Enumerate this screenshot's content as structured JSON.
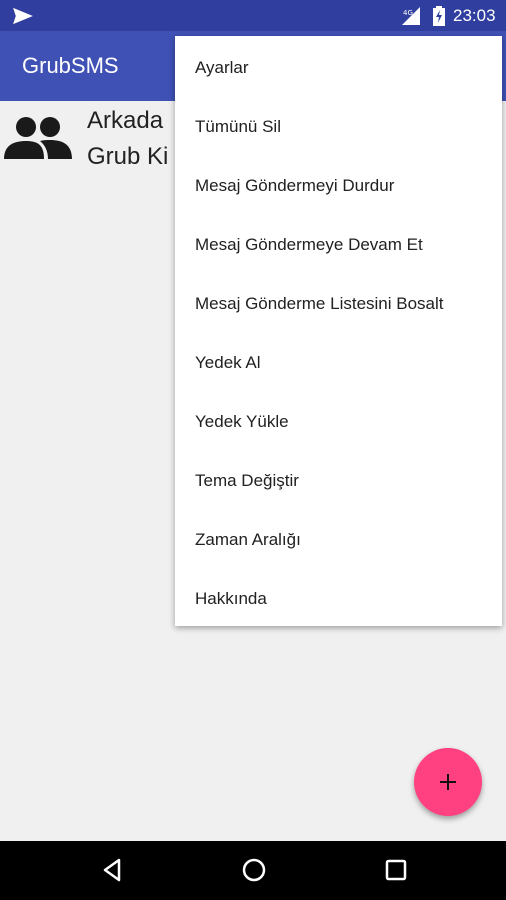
{
  "status_bar": {
    "time": "23:03",
    "network": "4G"
  },
  "app_bar": {
    "title": "GrubSMS"
  },
  "list": {
    "items": [
      {
        "line1": "Arkada",
        "line2": "Grub Ki"
      }
    ]
  },
  "overflow_menu": {
    "items": [
      "Ayarlar",
      "Tümünü Sil",
      "Mesaj Göndermeyi Durdur",
      "Mesaj Göndermeye Devam Et",
      "Mesaj Gönderme Listesini Bosalt",
      "Yedek Al",
      "Yedek Yükle",
      "Tema Değiştir",
      "Zaman Aralığı",
      "Hakkında"
    ]
  },
  "fab": {
    "icon": "plus-icon"
  },
  "colors": {
    "status_bar": "#303f9f",
    "app_bar": "#3f51b5",
    "fab": "#ff4081",
    "background": "#f0f0f0"
  }
}
